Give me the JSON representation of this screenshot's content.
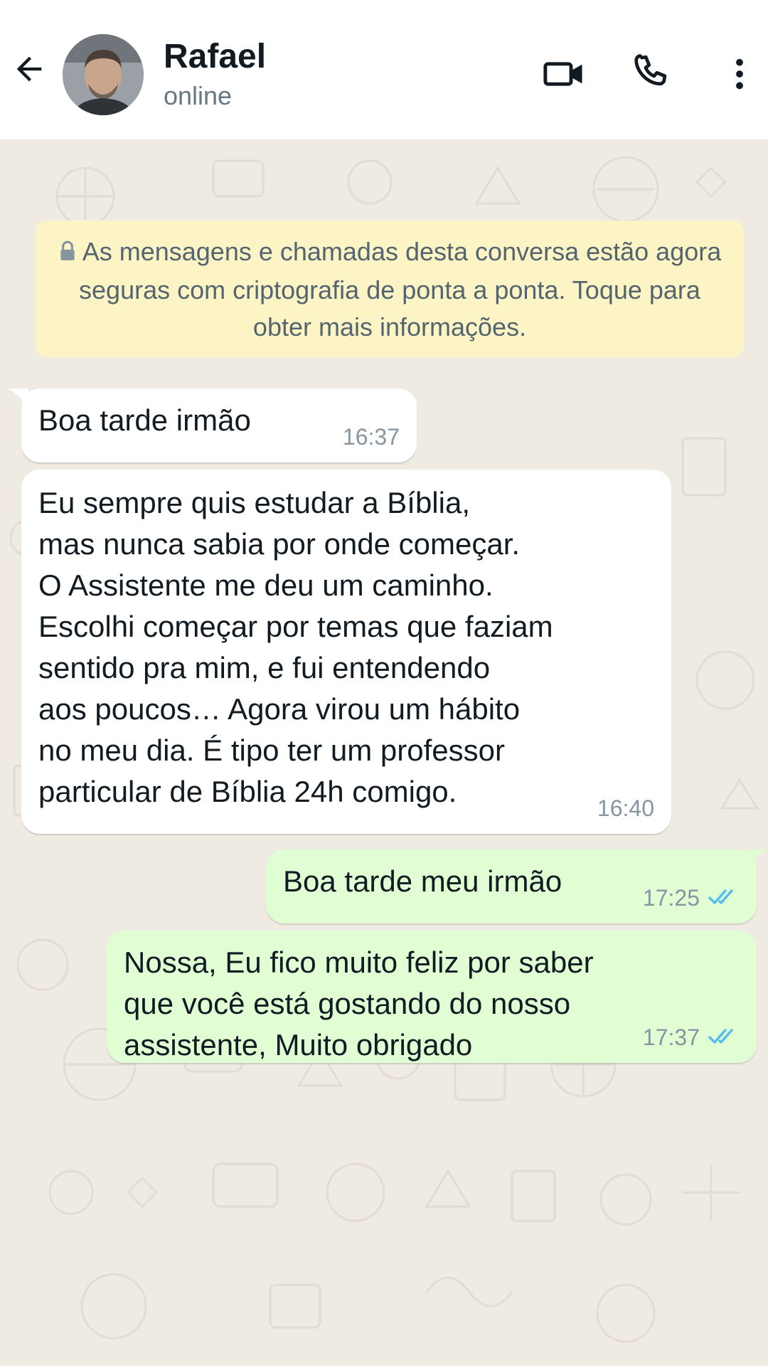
{
  "header": {
    "contact_name": "Rafael",
    "status": "online",
    "icons": {
      "back": "arrow-left-icon",
      "video": "video-camera-icon",
      "call": "phone-icon",
      "menu": "more-vertical-icon"
    }
  },
  "chat": {
    "encryption_notice": "As mensagens e chamadas desta conversa estão agora seguras com criptografia de ponta a ponta. Toque para obter mais informações.",
    "messages": [
      {
        "direction": "incoming",
        "text": "Boa tarde irmão",
        "time": "16:37"
      },
      {
        "direction": "incoming",
        "text": "Eu sempre quis estudar a Bíblia,\nmas nunca sabia por onde começar.\nO Assistente me deu um caminho.\nEscolhi começar por temas que faziam\nsentido pra mim, e fui entendendo\naos poucos… Agora virou um hábito\nno meu dia. É tipo ter um professor\nparticular de Bíblia 24h comigo.",
        "time": "16:40"
      },
      {
        "direction": "outgoing",
        "text": "Boa tarde meu irmão",
        "time": "17:25",
        "status": "read"
      },
      {
        "direction": "outgoing",
        "text": "Nossa, Eu fico muito feliz por saber\nque você está gostando do nosso\nassistente, Muito obrigado",
        "time": "17:37",
        "status": "read"
      }
    ]
  },
  "colors": {
    "chat_background": "#efeae2",
    "incoming_bubble": "#ffffff",
    "outgoing_bubble": "#e1fdd4",
    "notice_background": "#fdf4c5",
    "read_tick": "#53bdeb"
  }
}
